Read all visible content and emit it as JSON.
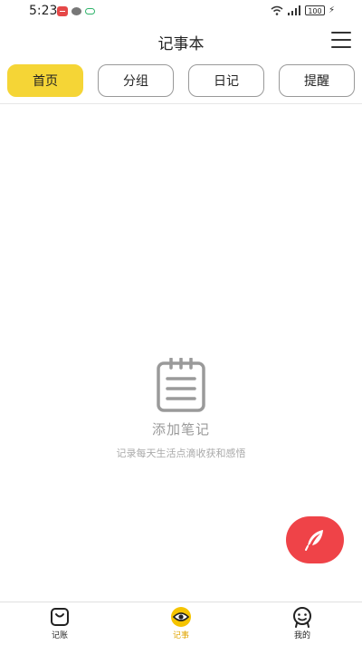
{
  "status_bar": {
    "time": "5:23",
    "battery": "100",
    "icons": [
      "notification-icon",
      "chat-bubble-icon",
      "cloud-icon",
      "wifi-icon",
      "signal-icon",
      "battery-icon",
      "charging-icon"
    ]
  },
  "header": {
    "title": "记事本",
    "menu_icon": "hamburger-menu-icon"
  },
  "tabs": [
    {
      "label": "首页",
      "active": true
    },
    {
      "label": "分组",
      "active": false
    },
    {
      "label": "日记",
      "active": false
    },
    {
      "label": "提醒",
      "active": false
    }
  ],
  "empty_state": {
    "icon": "notepad-icon",
    "title": "添加笔记",
    "subtitle": "记录每天生活点滴收获和感悟"
  },
  "fab": {
    "icon": "feather-pen-icon",
    "color": "#ef4348"
  },
  "bottom_nav": [
    {
      "label": "记账",
      "icon": "shopping-bag-icon",
      "active": false
    },
    {
      "label": "记事",
      "icon": "eye-icon",
      "active": true
    },
    {
      "label": "我的",
      "icon": "smiley-face-icon",
      "active": false
    }
  ],
  "colors": {
    "accent": "#f5d536",
    "active_nav": "#e0a400",
    "fab": "#ef4348"
  }
}
